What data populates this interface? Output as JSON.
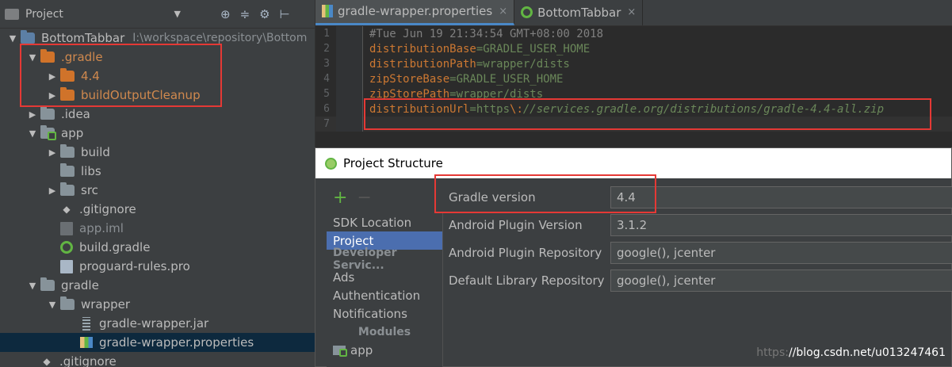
{
  "project_panel": {
    "title": "Project",
    "tools": [
      "⊕",
      "≑",
      "⚙",
      "⊢"
    ],
    "tree": [
      {
        "name": "BottomTabbar",
        "path": "I:\\workspace\\repository\\Bottom",
        "icon": "root-folder",
        "arrow": "▼",
        "indent": 0
      },
      {
        "name": ".gradle",
        "icon": "orange-folder",
        "arrow": "▼",
        "indent": 1,
        "style": "orange"
      },
      {
        "name": "4.4",
        "icon": "orange-folder",
        "arrow": "▶",
        "indent": 2,
        "style": "orange"
      },
      {
        "name": "buildOutputCleanup",
        "icon": "orange-folder",
        "arrow": "▶",
        "indent": 2,
        "style": "orange"
      },
      {
        "name": ".idea",
        "icon": "folder",
        "arrow": "▶",
        "indent": 1
      },
      {
        "name": "app",
        "icon": "module-folder",
        "arrow": "▼",
        "indent": 1
      },
      {
        "name": "build",
        "icon": "folder",
        "arrow": "▶",
        "indent": 2
      },
      {
        "name": "libs",
        "icon": "folder",
        "arrow": "",
        "indent": 2
      },
      {
        "name": "src",
        "icon": "folder",
        "arrow": "▶",
        "indent": 2
      },
      {
        "name": ".gitignore",
        "icon": "git-file",
        "arrow": "",
        "indent": 2
      },
      {
        "name": "app.iml",
        "icon": "iml-file",
        "arrow": "",
        "indent": 2,
        "style": "dim"
      },
      {
        "name": "build.gradle",
        "icon": "gradle-file",
        "arrow": "",
        "indent": 2
      },
      {
        "name": "proguard-rules.pro",
        "icon": "text-file",
        "arrow": "",
        "indent": 2
      },
      {
        "name": "gradle",
        "icon": "folder",
        "arrow": "▼",
        "indent": 1
      },
      {
        "name": "wrapper",
        "icon": "folder",
        "arrow": "▼",
        "indent": 2
      },
      {
        "name": "gradle-wrapper.jar",
        "icon": "jar-file",
        "arrow": "",
        "indent": 3
      },
      {
        "name": "gradle-wrapper.properties",
        "icon": "properties-file",
        "arrow": "",
        "indent": 3,
        "selected": true
      },
      {
        "name": ".gitignore",
        "icon": "git-file",
        "arrow": "",
        "indent": 1
      }
    ]
  },
  "editor": {
    "tabs": [
      {
        "label": "gradle-wrapper.properties",
        "active": true
      },
      {
        "label": "BottomTabbar",
        "active": false
      }
    ],
    "close_glyph": "×",
    "lines": [
      {
        "num": "1",
        "parts": [
          {
            "t": "#Tue Jun 19 21:34:54 GMT+08:00 2018",
            "c": "comment"
          }
        ]
      },
      {
        "num": "2",
        "parts": [
          {
            "t": "distributionBase",
            "c": "key"
          },
          {
            "t": "=GRADLE_USER_HOME",
            "c": "val"
          }
        ]
      },
      {
        "num": "3",
        "parts": [
          {
            "t": "distributionPath",
            "c": "key"
          },
          {
            "t": "=wrapper/dists",
            "c": "val"
          }
        ]
      },
      {
        "num": "4",
        "parts": [
          {
            "t": "zipStoreBase",
            "c": "key"
          },
          {
            "t": "=GRADLE_USER_HOME",
            "c": "val"
          }
        ]
      },
      {
        "num": "5",
        "parts": [
          {
            "t": "zipStorePath",
            "c": "key"
          },
          {
            "t": "=wrapper/dists",
            "c": "val"
          }
        ]
      },
      {
        "num": "6",
        "parts": [
          {
            "t": "distributionUrl",
            "c": "key"
          },
          {
            "t": "=https",
            "c": "val"
          },
          {
            "t": "\\:",
            "c": "esc"
          },
          {
            "t": "//services.gradle.org/distributions/gradle-4.4-all.zip",
            "c": "url"
          }
        ]
      },
      {
        "num": "7",
        "parts": [],
        "caret": true
      }
    ]
  },
  "dialog": {
    "title": "Project Structure",
    "add_glyph": "+",
    "remove_glyph": "−",
    "sidebar": [
      {
        "label": "SDK Location"
      },
      {
        "label": "Project",
        "selected": true
      },
      {
        "label": "Developer Servic...",
        "section": true
      },
      {
        "label": "Ads"
      },
      {
        "label": "Authentication"
      },
      {
        "label": "Notifications"
      },
      {
        "label": "Modules",
        "section": true,
        "center": true
      },
      {
        "label": "app",
        "module": true
      }
    ],
    "fields": [
      {
        "label": "Gradle version",
        "value": "4.4"
      },
      {
        "label": "Android Plugin Version",
        "value": "3.1.2"
      },
      {
        "label": "Android Plugin Repository",
        "value": "google(), jcenter"
      },
      {
        "label": "Default Library Repository",
        "value": "google(), jcenter"
      }
    ]
  },
  "watermark": {
    "faint": "https:",
    "text": "//blog.csdn.net/u013247461"
  },
  "colors": {
    "highlight": "#e53935",
    "accent": "#4b6eaf",
    "android_green": "#62b543"
  }
}
